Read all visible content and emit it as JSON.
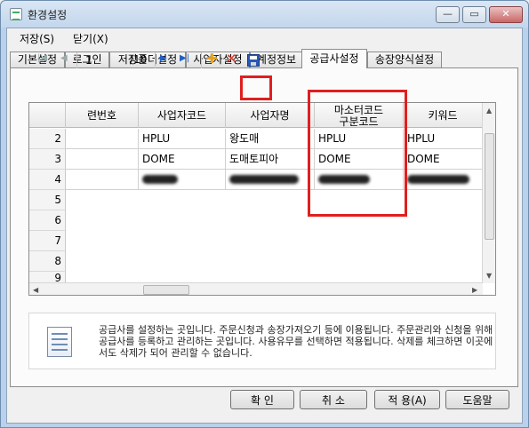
{
  "window": {
    "title": "환경설정",
    "controls": {
      "minimize": "—",
      "maximize": "▭",
      "close": "✕"
    }
  },
  "menu": [
    {
      "label": "저장(S)"
    },
    {
      "label": "닫기(X)"
    }
  ],
  "tabs": [
    {
      "label": "기본설정"
    },
    {
      "label": "로그인"
    },
    {
      "label": "저장폴더설정"
    },
    {
      "label": "사업자설정"
    },
    {
      "label": "계정정보"
    },
    {
      "label": "공급사설정",
      "active": true
    },
    {
      "label": "송장양식설정"
    }
  ],
  "toolbar": {
    "current_page": "1",
    "total_pages": "/10",
    "icons": {
      "first": "first-page-icon",
      "prev": "prev-page-icon",
      "next": "next-page-icon",
      "last": "last-page-icon",
      "add": "add-icon",
      "delete": "delete-icon",
      "save": "save-icon"
    },
    "glyphs": {
      "first": "|◀",
      "prev": "◀",
      "next": "▶",
      "last": "▶|",
      "add": "✚",
      "delete": "✕"
    }
  },
  "grid": {
    "columns": [
      "련번호",
      "사업자코드",
      "사업자명",
      "마소터코드",
      "구분코드",
      "키워드"
    ],
    "rows": [
      {
        "num": "2",
        "c1": "",
        "c2": "HPLU",
        "c3": "왕도매",
        "c4": "HPLU",
        "c5": "HPLU"
      },
      {
        "num": "3",
        "c1": "",
        "c2": "DOME",
        "c3": "도매토피아",
        "c4": "DOME",
        "c5": "DOME"
      },
      {
        "num": "4",
        "c1": "",
        "c2": "",
        "c3": "",
        "c4": "",
        "c5": ""
      },
      {
        "num": "5"
      },
      {
        "num": "6"
      },
      {
        "num": "7"
      },
      {
        "num": "8"
      },
      {
        "num": "9"
      }
    ]
  },
  "info": {
    "text": "공급사를 설정하는 곳입니다. 주문신청과 송장가져오기 등에 이용됩니다. 주문관리와 신청을 위해 공급사를 등록하고 관리하는 곳입니다. 사용유무를 선택하면 적용됩니다. 삭제를 체크하면 이곳에서도 삭제가 되어 관리할 수 없습니다."
  },
  "buttons": {
    "ok": "확 인",
    "cancel": "취 소",
    "apply": "적 용(A)",
    "help": "도움말"
  },
  "highlight_color": "#e01f1f"
}
